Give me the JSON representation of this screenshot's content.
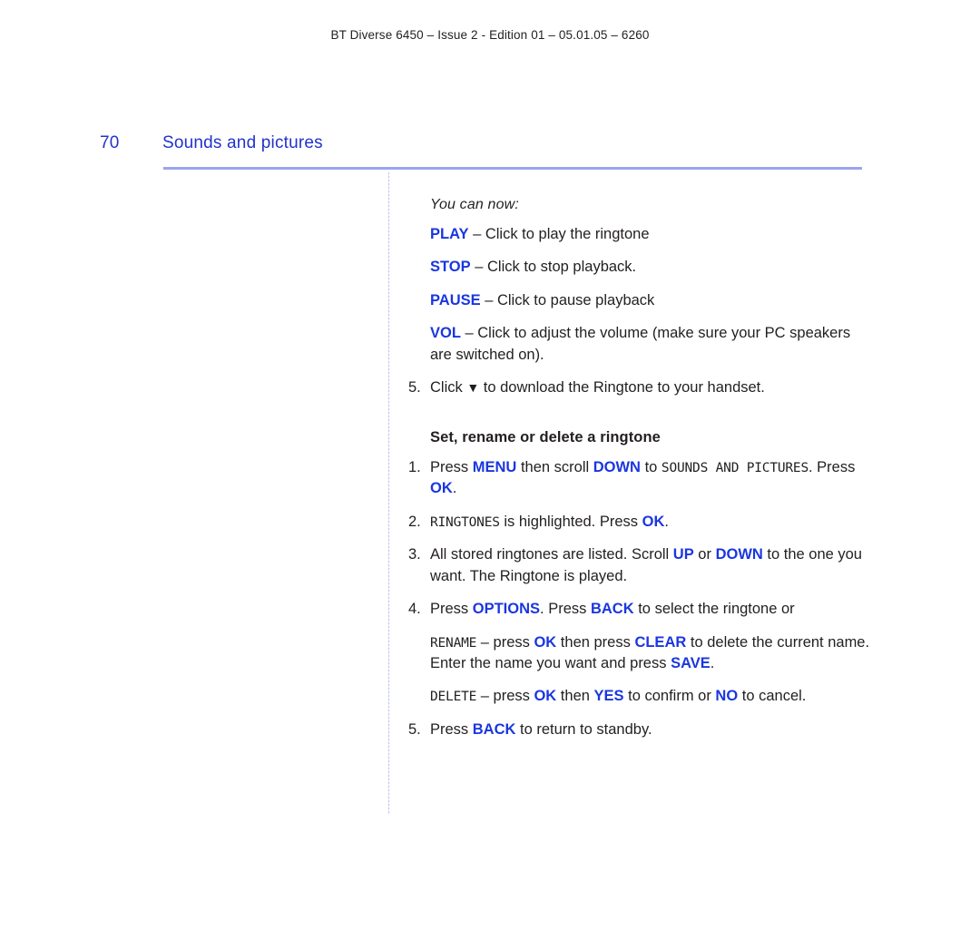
{
  "header": {
    "running_text": "BT Diverse 6450 – Issue 2 - Edition 01 – 05.01.05 – 6260"
  },
  "page": {
    "number": "70",
    "section_title": "Sounds and pictures"
  },
  "colors": {
    "accent_blue": "#1a36e0",
    "heading_blue": "#2233cc",
    "rule_blue": "#9aa4f2",
    "text": "#231f20"
  },
  "content": {
    "intro": "You can now:",
    "definitions": [
      {
        "term": "PLAY",
        "rest": " – Click to play the ringtone"
      },
      {
        "term": "STOP",
        "rest": " – Click to stop playback."
      },
      {
        "term": "PAUSE",
        "rest": " – Click to pause playback"
      },
      {
        "term": "VOL",
        "rest": " – Click to adjust the volume (make sure your PC speakers are switched on)."
      }
    ],
    "step5_download": {
      "num": "5.",
      "text_before": "Click ",
      "icon": "▼",
      "text_after": " to download the Ringtone to your handset."
    },
    "subheading": "Set, rename or delete a ringtone",
    "steps": [
      {
        "num": "1.",
        "parts": [
          {
            "t": "plain",
            "v": "Press "
          },
          {
            "t": "key",
            "v": "MENU"
          },
          {
            "t": "plain",
            "v": " then scroll "
          },
          {
            "t": "key",
            "v": "DOWN"
          },
          {
            "t": "plain",
            "v": " to "
          },
          {
            "t": "lcd",
            "v": "SOUNDS AND PICTURES"
          },
          {
            "t": "plain",
            "v": ". Press "
          },
          {
            "t": "key",
            "v": "OK"
          },
          {
            "t": "plain",
            "v": "."
          }
        ]
      },
      {
        "num": "2.",
        "parts": [
          {
            "t": "lcd",
            "v": "RINGTONES"
          },
          {
            "t": "plain",
            "v": " is highlighted. Press "
          },
          {
            "t": "key",
            "v": "OK"
          },
          {
            "t": "plain",
            "v": "."
          }
        ]
      },
      {
        "num": "3.",
        "parts": [
          {
            "t": "plain",
            "v": "All stored ringtones are listed. Scroll "
          },
          {
            "t": "key",
            "v": "UP"
          },
          {
            "t": "plain",
            "v": " or "
          },
          {
            "t": "key",
            "v": "DOWN"
          },
          {
            "t": "plain",
            "v": " to the one you want. The Ringtone is played."
          }
        ]
      },
      {
        "num": "4.",
        "parts": [
          {
            "t": "plain",
            "v": "Press "
          },
          {
            "t": "key",
            "v": "OPTIONS"
          },
          {
            "t": "plain",
            "v": ". Press "
          },
          {
            "t": "key",
            "v": "BACK"
          },
          {
            "t": "plain",
            "v": " to select the ringtone or"
          }
        ],
        "substeps": [
          [
            {
              "t": "lcd",
              "v": "RENAME"
            },
            {
              "t": "plain",
              "v": " – press "
            },
            {
              "t": "key",
              "v": "OK"
            },
            {
              "t": "plain",
              "v": " then press "
            },
            {
              "t": "key",
              "v": "CLEAR"
            },
            {
              "t": "plain",
              "v": " to delete the current name. Enter the name you want and press "
            },
            {
              "t": "key",
              "v": "SAVE"
            },
            {
              "t": "plain",
              "v": "."
            }
          ],
          [
            {
              "t": "lcd",
              "v": "DELETE"
            },
            {
              "t": "plain",
              "v": " – press "
            },
            {
              "t": "key",
              "v": "OK"
            },
            {
              "t": "plain",
              "v": " then "
            },
            {
              "t": "key",
              "v": "YES"
            },
            {
              "t": "plain",
              "v": " to confirm or "
            },
            {
              "t": "key",
              "v": "NO"
            },
            {
              "t": "plain",
              "v": " to cancel."
            }
          ]
        ]
      },
      {
        "num": "5.",
        "parts": [
          {
            "t": "plain",
            "v": "Press "
          },
          {
            "t": "key",
            "v": "BACK"
          },
          {
            "t": "plain",
            "v": " to return to standby."
          }
        ]
      }
    ]
  }
}
